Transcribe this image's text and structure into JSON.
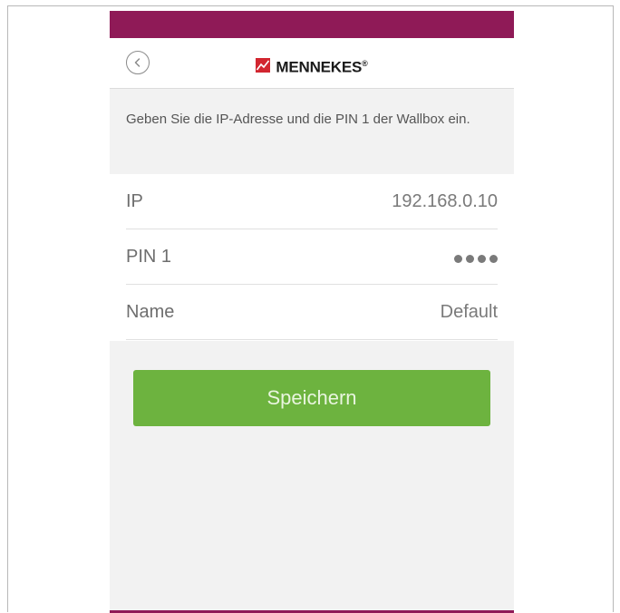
{
  "app": {
    "brand_name": "MENNEKES",
    "brand_mark": "®",
    "back_icon": "chevron-left-icon",
    "logo_icon": "mennekes-logo-icon",
    "colors": {
      "status_bar": "#8f1a57",
      "accent_button": "#6db33f",
      "logo_red": "#d22630"
    }
  },
  "screen": {
    "instruction": "Geben Sie die IP-Adresse und die PIN 1 der Wallbox ein.",
    "fields": [
      {
        "label": "IP",
        "value": "192.168.0.10"
      },
      {
        "label": "PIN 1",
        "value_masked_length": 4
      },
      {
        "label": "Name",
        "value": "Default"
      }
    ],
    "save_label": "Speichern"
  }
}
